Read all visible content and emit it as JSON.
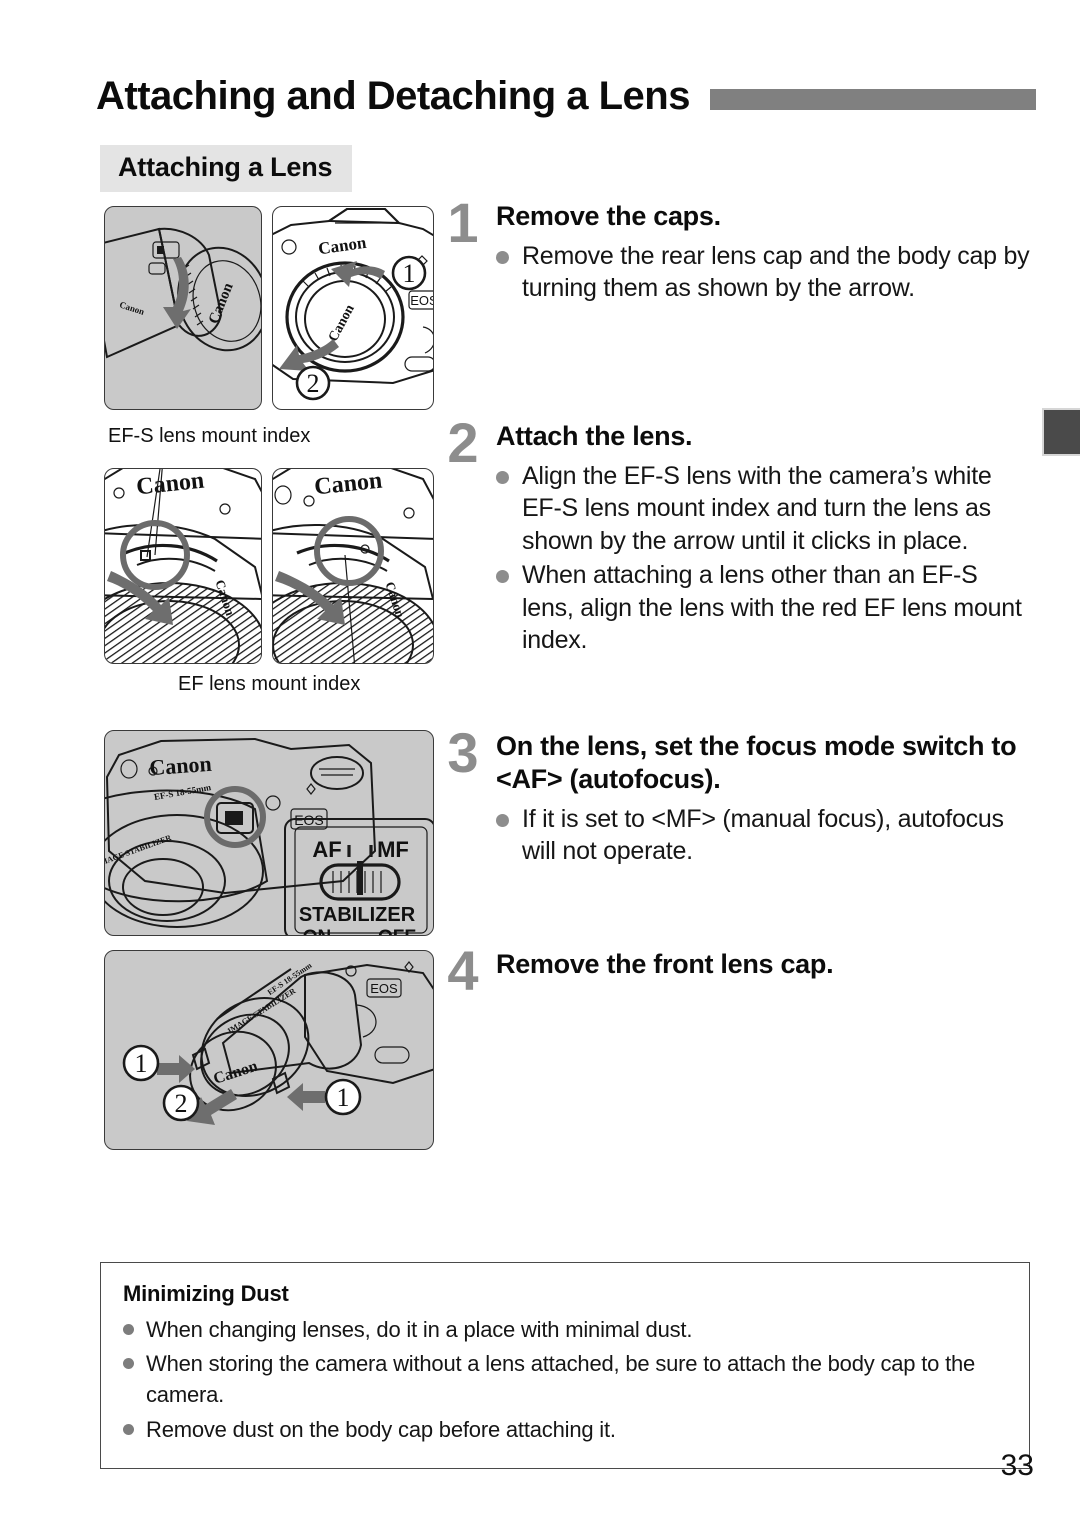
{
  "page": {
    "title": "Attaching and Detaching a Lens",
    "subheading": "Attaching a Lens",
    "page_number": "33",
    "rule_color": "#808080",
    "subhead_bg": "#e4e4e4",
    "step_number_color": "#8d8d8d",
    "bullet_color": "#8d8d8d",
    "edge_tab_color": "#4a4a4a"
  },
  "figures": {
    "step1": {
      "left_panel_label": "lens-rear-cap-removal",
      "right_panel_label": "camera-body-cap-removal",
      "callout_1": "1",
      "callout_2": "2",
      "brand": "Canon",
      "mount_text": "EOS"
    },
    "step2": {
      "caption_top": "EF-S lens mount index",
      "caption_bottom": "EF lens mount index",
      "brand": "Canon"
    },
    "step3": {
      "brand": "Canon",
      "mount_text": "EOS",
      "switch_af": "AF",
      "switch_mf": "MF",
      "stabilizer_label": "STABILIZER",
      "stabilizer_on": "ON",
      "stabilizer_off": "OFF"
    },
    "step4": {
      "brand": "Canon",
      "mount_text": "EOS",
      "callout_1a": "1",
      "callout_1b": "1",
      "callout_2": "2"
    }
  },
  "steps": [
    {
      "number": "1",
      "title": "Remove the caps.",
      "bullets": [
        "Remove the rear lens cap and the body cap by turning them as shown by the arrow."
      ]
    },
    {
      "number": "2",
      "title": "Attach the lens.",
      "bullets": [
        "Align the EF-S lens with the camera’s white EF-S lens mount index and turn the lens as shown by the arrow until it clicks in place.",
        "When attaching a lens other than an EF-S lens, align the lens with the red EF lens mount index."
      ]
    },
    {
      "number": "3",
      "title": "On the lens, set the focus mode switch to <AF> (autofocus).",
      "bullets": [
        "If it is set to <MF> (manual focus), autofocus will not operate."
      ]
    },
    {
      "number": "4",
      "title": "Remove the front lens cap.",
      "bullets": []
    }
  ],
  "note": {
    "title": "Minimizing Dust",
    "items": [
      "When changing lenses, do it in a place with minimal dust.",
      "When storing the camera without a lens attached, be sure to attach the body cap to the camera.",
      "Remove dust on the body cap before attaching it."
    ]
  }
}
